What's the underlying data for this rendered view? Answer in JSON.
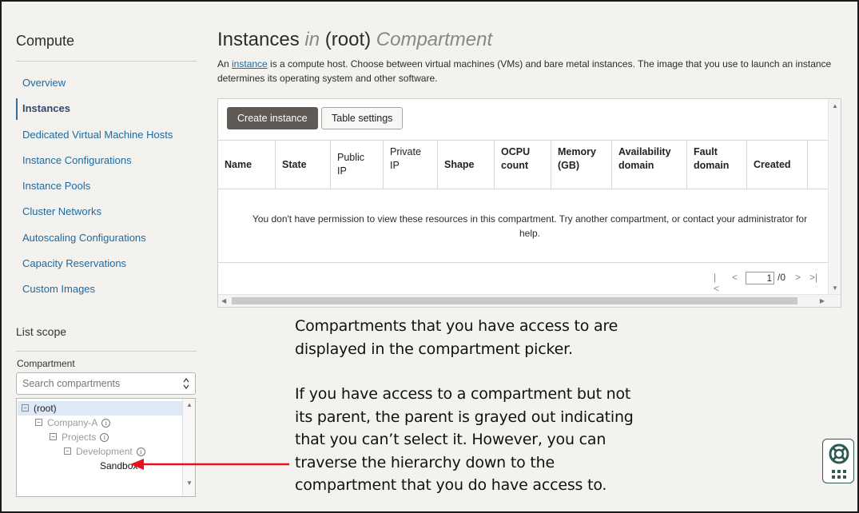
{
  "sidebar": {
    "title": "Compute",
    "nav": [
      "Overview",
      "Instances",
      "Dedicated Virtual Machine Hosts",
      "Instance Configurations",
      "Instance Pools",
      "Cluster Networks",
      "Autoscaling Configurations",
      "Capacity Reservations",
      "Custom Images"
    ],
    "active": "Instances",
    "scope_title": "List scope",
    "compartment_label": "Compartment",
    "search_placeholder": "Search compartments",
    "tree": {
      "root": "(root)",
      "company": "Company-A",
      "projects": "Projects",
      "development": "Development",
      "sandbox": "Sandbox"
    }
  },
  "main": {
    "title_a": "Instances",
    "title_b": "in",
    "title_c": "(root)",
    "title_d": "Compartment",
    "desc_pre": "An ",
    "desc_link": "instance",
    "desc_post": " is a compute host. Choose between virtual machines (VMs) and bare metal instances. The image that you use to launch an instance determines its operating system and other software.",
    "create_button": "Create instance",
    "settings_button": "Table settings",
    "columns": [
      "Name",
      "State",
      "Public IP",
      "Private IP",
      "Shape",
      "OCPU count",
      "Memory (GB)",
      "Availability domain",
      "Fault domain",
      "Created"
    ],
    "empty_message": "You don't have permission to view these resources in this compartment. Try another compartment, or contact your administrator for help.",
    "pager": {
      "current": "1",
      "total": "/0"
    }
  },
  "annotation": {
    "p1_l1": "Compartments that you have access to are",
    "p1_l2": "displayed in the compartment picker.",
    "p2_l1": "If you have access to a compartment but not",
    "p2_l2": "its parent, the parent is grayed out indicating",
    "p2_l3": "that you can’t select it. However, you can",
    "p2_l4": "traverse the hierarchy down to the",
    "p2_l5": "compartment that you do have access to."
  },
  "colors": {
    "link": "#1d6aa0",
    "primary_button": "#5f5a55",
    "arrow": "#e8101a",
    "background": "#f3f2ef"
  },
  "icons": [
    "chevron-updown-icon",
    "expand-collapse-icon",
    "info-icon",
    "first-page-icon",
    "prev-page-icon",
    "next-page-icon",
    "last-page-icon",
    "lifebuoy-icon",
    "grid-icon",
    "red-arrow-icon"
  ]
}
